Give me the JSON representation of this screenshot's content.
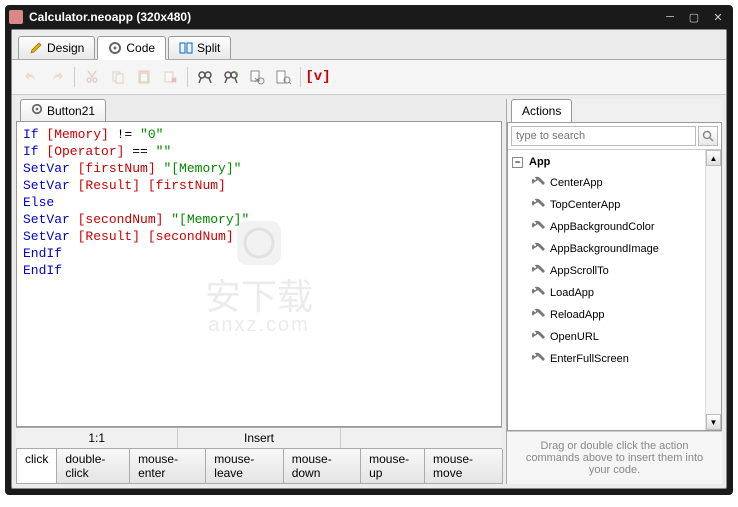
{
  "window": {
    "title": "Calculator.neoapp (320x480)"
  },
  "tabs": {
    "design": "Design",
    "code": "Code",
    "split": "Split"
  },
  "code_tab": {
    "label": "Button21"
  },
  "code_lines": [
    [
      {
        "t": "If ",
        "c": "kw"
      },
      {
        "t": "[Memory]",
        "c": "br"
      },
      {
        "t": " != ",
        "c": ""
      },
      {
        "t": "\"0\"",
        "c": "str"
      }
    ],
    [
      {
        "t": "  If ",
        "c": "kw"
      },
      {
        "t": "[Operator]",
        "c": "br"
      },
      {
        "t": " == ",
        "c": ""
      },
      {
        "t": "\"\"",
        "c": "str"
      }
    ],
    [
      {
        "t": "    SetVar ",
        "c": "kw"
      },
      {
        "t": "[firstNum]",
        "c": "br"
      },
      {
        "t": " ",
        "c": ""
      },
      {
        "t": "\"[Memory]\"",
        "c": "str"
      }
    ],
    [
      {
        "t": "    SetVar ",
        "c": "kw"
      },
      {
        "t": "[Result]",
        "c": "br"
      },
      {
        "t": " ",
        "c": ""
      },
      {
        "t": "[firstNum]",
        "c": "br"
      }
    ],
    [
      {
        "t": "  Else",
        "c": "kw"
      }
    ],
    [
      {
        "t": "    SetVar ",
        "c": "kw"
      },
      {
        "t": "[secondNum]",
        "c": "br"
      },
      {
        "t": " ",
        "c": ""
      },
      {
        "t": "\"[Memory]\"",
        "c": "str"
      }
    ],
    [
      {
        "t": "    SetVar ",
        "c": "kw"
      },
      {
        "t": "[Result]",
        "c": "br"
      },
      {
        "t": " ",
        "c": ""
      },
      {
        "t": "[secondNum]",
        "c": "br"
      }
    ],
    [
      {
        "t": "  EndIf",
        "c": "kw"
      }
    ],
    [
      {
        "t": "EndIf",
        "c": "kw"
      }
    ]
  ],
  "status": {
    "pos": "1:1",
    "mode": "Insert"
  },
  "events": [
    "click",
    "double-click",
    "mouse-enter",
    "mouse-leave",
    "mouse-down",
    "mouse-up",
    "mouse-move"
  ],
  "actions": {
    "panel_title": "Actions",
    "search_placeholder": "type to search",
    "group": "App",
    "items": [
      "CenterApp",
      "TopCenterApp",
      "AppBackgroundColor",
      "AppBackgroundImage",
      "AppScrollTo",
      "LoadApp",
      "ReloadApp",
      "OpenURL",
      "EnterFullScreen"
    ],
    "hint": "Drag or double click the action commands above to insert them into your code."
  },
  "vmark": "[v]"
}
